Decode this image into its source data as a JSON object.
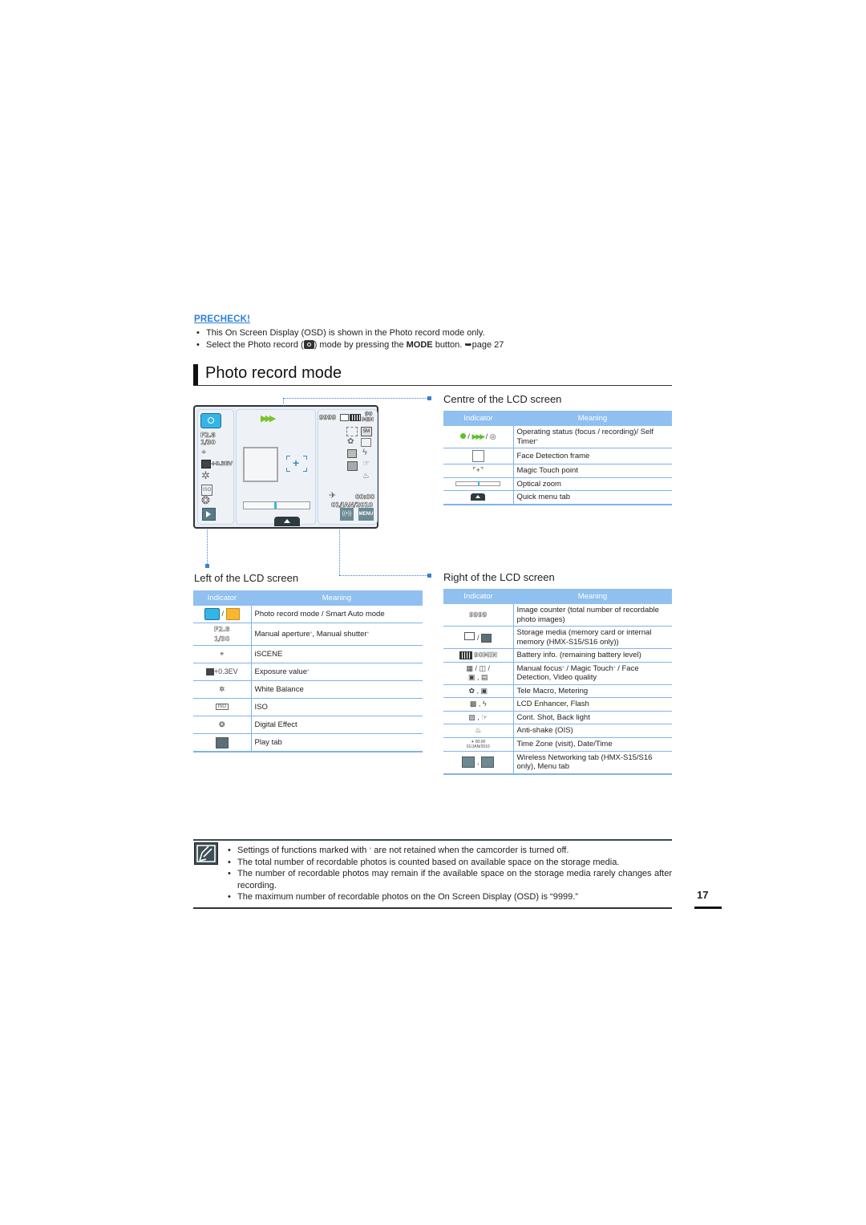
{
  "precheck": {
    "label": "PRECHECK!",
    "bullets": [
      "This On Screen Display (OSD) is shown in the Photo record mode only.",
      {
        "pre": "Select the Photo record (",
        "post": ") mode by pressing the ",
        "bold": "MODE",
        "tail": " button. ➥page 27"
      }
    ]
  },
  "section_title": "Photo record mode",
  "lcd": {
    "aperture": "F2.8",
    "shutter": "1/30",
    "exposure": "+0.3EV",
    "counter": "9999",
    "battery_time": "90",
    "battery_unit": "MIN",
    "time": "00:00",
    "date": "01/JAN/2010",
    "menu_label": "MENU",
    "zoom_level": 0.5
  },
  "centre": {
    "title": "Centre of the LCD screen",
    "headers": [
      "Indicator",
      "Meaning"
    ],
    "rows": [
      {
        "icon": "focus-recording-selftimer-icons",
        "meaning": "Operating status (focus / recording)/ Self Timer",
        "star": true
      },
      {
        "icon": "face-detection-frame-icon",
        "meaning": "Face Detection frame"
      },
      {
        "icon": "magic-touch-point-icon",
        "meaning": "Magic Touch point"
      },
      {
        "icon": "optical-zoom-bar-icon",
        "meaning": "Optical zoom"
      },
      {
        "icon": "quick-menu-tab-icon",
        "meaning": "Quick menu tab"
      }
    ]
  },
  "left": {
    "title": "Left of the LCD screen",
    "headers": [
      "Indicator",
      "Meaning"
    ],
    "rows": [
      {
        "icon": "photo-smart-auto-icons",
        "meaning": "Photo record mode / Smart Auto mode"
      },
      {
        "icon_text": "F2.8 1/30",
        "meaning_a": "Manual aperture",
        "meaning_b": ", Manual shutter"
      },
      {
        "icon": "iscene-icon",
        "meaning": "iSCENE"
      },
      {
        "icon_text": "+0.3EV",
        "meaning": "Exposure value",
        "star": true
      },
      {
        "icon": "white-balance-icon",
        "meaning": "White Balance"
      },
      {
        "icon": "iso-icon",
        "meaning": "ISO"
      },
      {
        "icon": "digital-effect-icon",
        "meaning": "Digital Effect"
      },
      {
        "icon": "play-tab-icon",
        "meaning": "Play tab"
      }
    ]
  },
  "right": {
    "title": "Right of the LCD screen",
    "headers": [
      "Indicator",
      "Meaning"
    ],
    "rows": [
      {
        "icon_text": "9999",
        "meaning": "Image counter (total number of recordable photo images)"
      },
      {
        "icon": "storage-media-icons",
        "meaning": "Storage media (memory card or internal memory (HMX-S15/S16 only))"
      },
      {
        "icon_text": "90MIN",
        "meaning": "Battery info. (remaining battery level)"
      },
      {
        "icon": "focus-touch-face-quality-icons",
        "meaning_a": "Manual focus",
        "meaning_b": " / Magic Touch",
        "meaning_c": " / Face Detection, Video quality"
      },
      {
        "icon": "tele-macro-metering-icons",
        "meaning": "Tele Macro, Metering"
      },
      {
        "icon": "lcd-enhancer-flash-icons",
        "meaning": "LCD Enhancer, Flash"
      },
      {
        "icon": "cont-shot-backlight-icons",
        "meaning": "Cont. Shot, Back light"
      },
      {
        "icon": "anti-shake-icon",
        "meaning": "Anti-shake (OIS)"
      },
      {
        "icon_text": "00:00 01/JAN/2010",
        "meaning": "Time Zone (visit), Date/Time"
      },
      {
        "icon": "wireless-menu-tab-icons",
        "meaning": "Wireless Networking tab (HMX-S15/S16 only), Menu tab"
      }
    ]
  },
  "notes": [
    {
      "pre": "Settings of functions marked with ",
      "star": "*",
      "post": " are not retained when the camcorder is turned off."
    },
    "The total number of recordable photos is counted based on available space on the storage media.",
    "The number of recordable photos may remain if the available space on the storage media rarely changes after recording.",
    "The maximum number of recordable photos on the On Screen Display (OSD) is “9999.”"
  ],
  "page_number": "17",
  "colors": {
    "accent": "#2a7fd6",
    "table_header": "#8fc0f0",
    "table_rule": "#7fb4e8",
    "status_green": "#5cc02a",
    "camera_blue": "#35b4e6"
  }
}
